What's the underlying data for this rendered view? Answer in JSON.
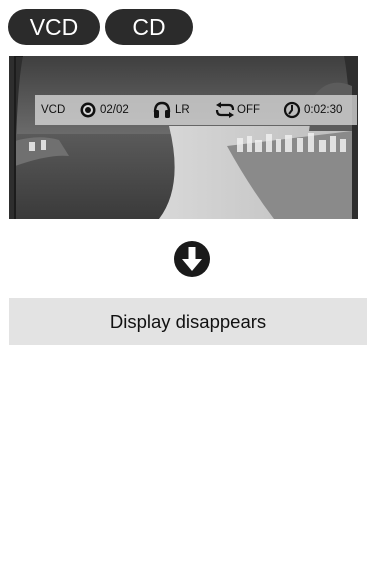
{
  "header": {
    "badges": [
      {
        "label": "VCD"
      },
      {
        "label": "CD"
      }
    ]
  },
  "screen": {
    "osd": {
      "disc_type": "VCD",
      "track": "02/02",
      "audio": "LR",
      "repeat": "OFF",
      "time": "0:02:30"
    }
  },
  "step": {
    "arrow_icon": "down-arrow-icon"
  },
  "caption": {
    "text": "Display disappears"
  }
}
